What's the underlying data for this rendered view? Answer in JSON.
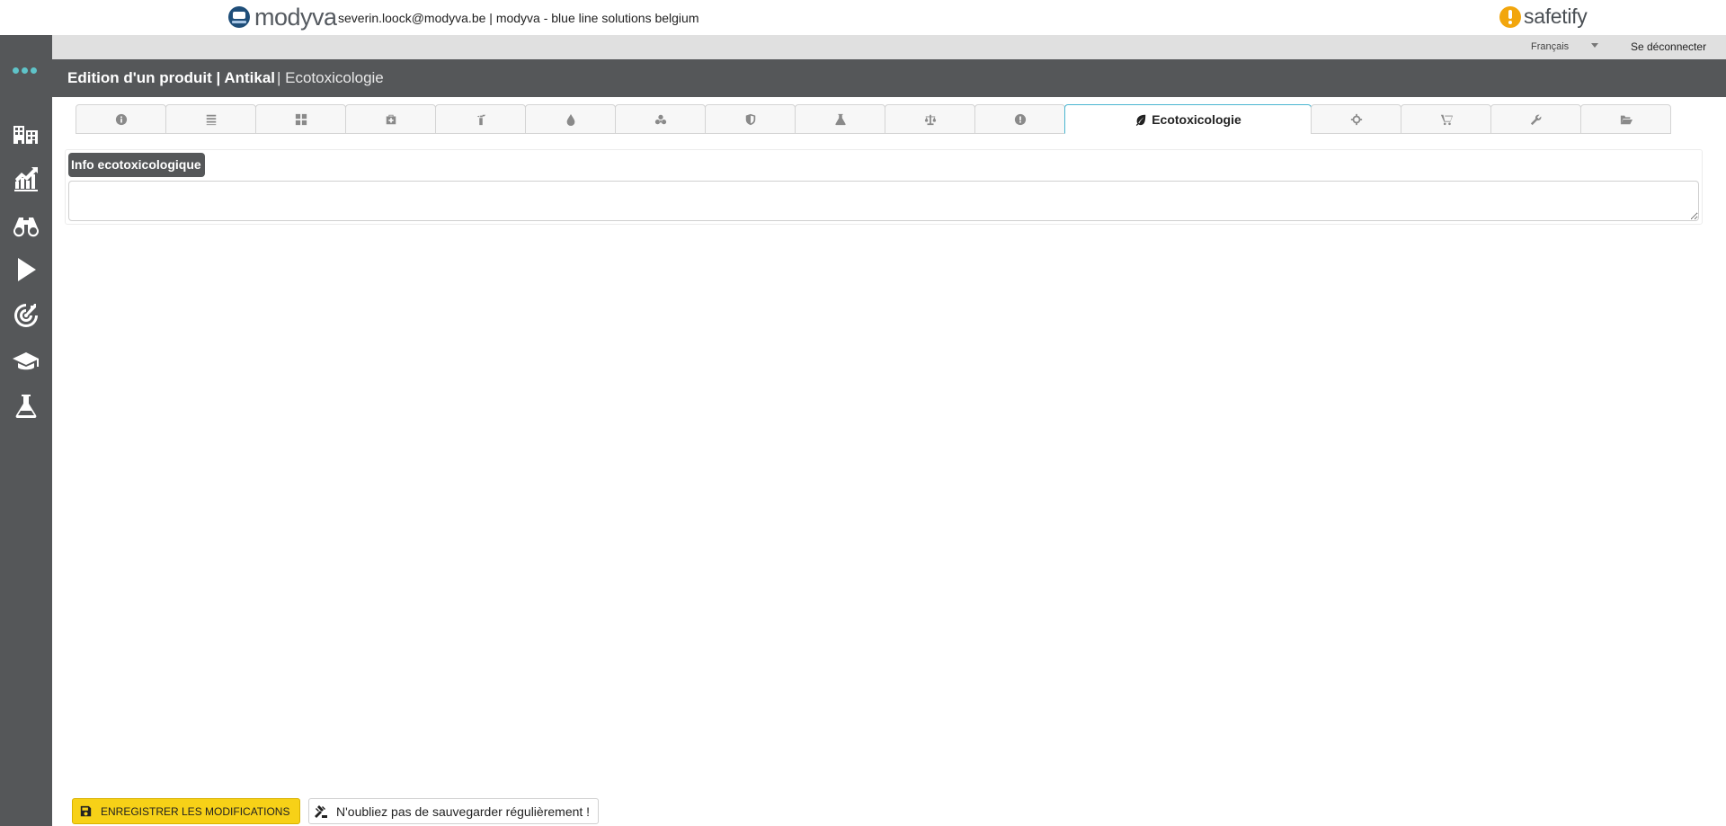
{
  "header": {
    "brand": "modyva",
    "user_info": "severin.loock@modyva.be | modyva - blue line solutions belgium",
    "partner_brand": "safetify"
  },
  "subbar": {
    "language": "Français",
    "logout": "Se déconnecter"
  },
  "titlebar": {
    "title": "Edition d'un produit | Antikal",
    "section": "| Ecotoxicologie"
  },
  "sidebar": {
    "items": [
      {
        "icon": "dots-icon"
      },
      {
        "icon": "buildings-icon"
      },
      {
        "icon": "chart-growth-icon"
      },
      {
        "icon": "binoculars-icon"
      },
      {
        "icon": "play-icon"
      },
      {
        "icon": "target-icon"
      },
      {
        "icon": "graduation-cap-icon"
      },
      {
        "icon": "flask-icon"
      }
    ]
  },
  "tabs": [
    {
      "icon": "info-icon"
    },
    {
      "icon": "list-icon"
    },
    {
      "icon": "grid-icon"
    },
    {
      "icon": "first-aid-icon"
    },
    {
      "icon": "fire-extinguisher-icon"
    },
    {
      "icon": "drop-icon"
    },
    {
      "icon": "hazard-icon"
    },
    {
      "icon": "shield-icon"
    },
    {
      "icon": "flask-icon"
    },
    {
      "icon": "scale-icon"
    },
    {
      "icon": "warning-icon"
    },
    {
      "icon": "leaf-icon",
      "label": "Ecotoxicologie",
      "active": true
    },
    {
      "icon": "crosshair-icon"
    },
    {
      "icon": "cart-icon"
    },
    {
      "icon": "wrench-icon"
    },
    {
      "icon": "folder-open-icon"
    }
  ],
  "panel": {
    "legend": "Info ecotoxicologique",
    "textarea_value": ""
  },
  "footer": {
    "save_label": "ENREGISTRER LES MODIFICATIONS",
    "reminder": "N'oubliez pas de sauvegarder régulièrement !"
  },
  "colors": {
    "sidebar_bg": "#555759",
    "accent_teal": "#5fc4c9",
    "active_tab_border": "#4bb6d1",
    "save_button": "#f7d117",
    "safetify_orange": "#f2a60d"
  }
}
